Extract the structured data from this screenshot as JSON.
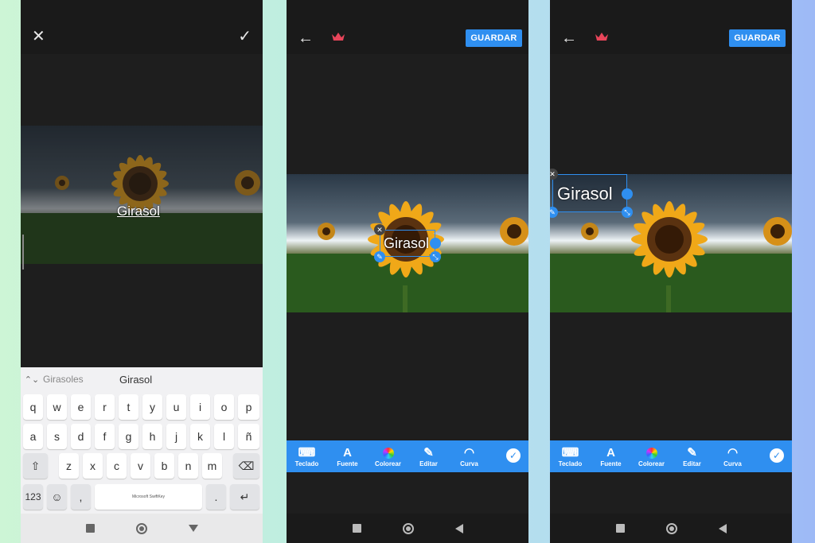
{
  "panel1": {
    "close_icon": "close-icon",
    "confirm_icon": "check-icon",
    "text": "Girasol",
    "suggestions": [
      "Girasoles",
      "Girasol"
    ],
    "keys": {
      "row1": [
        "q",
        "w",
        "e",
        "r",
        "t",
        "y",
        "u",
        "i",
        "o",
        "p"
      ],
      "row2": [
        "a",
        "s",
        "d",
        "f",
        "g",
        "h",
        "j",
        "k",
        "l",
        "ñ"
      ],
      "row3": [
        "z",
        "x",
        "c",
        "v",
        "b",
        "n",
        "m"
      ],
      "numbers_key": "123",
      "comma_key": ",",
      "period_key": ".",
      "space_label": "Microsoft SwiftKey"
    }
  },
  "panel2": {
    "save_label": "GUARDAR",
    "text": "Girasol",
    "tools": [
      "Teclado",
      "Fuente",
      "Colorear",
      "Editar",
      "Curva"
    ]
  },
  "panel3": {
    "save_label": "GUARDAR",
    "text": "Girasol",
    "tools": [
      "Teclado",
      "Fuente",
      "Colorear",
      "Editar",
      "Curva"
    ]
  },
  "colors": {
    "accent": "#2f8ff0",
    "crown": "#e8455a",
    "dark": "#1e1e1e"
  }
}
